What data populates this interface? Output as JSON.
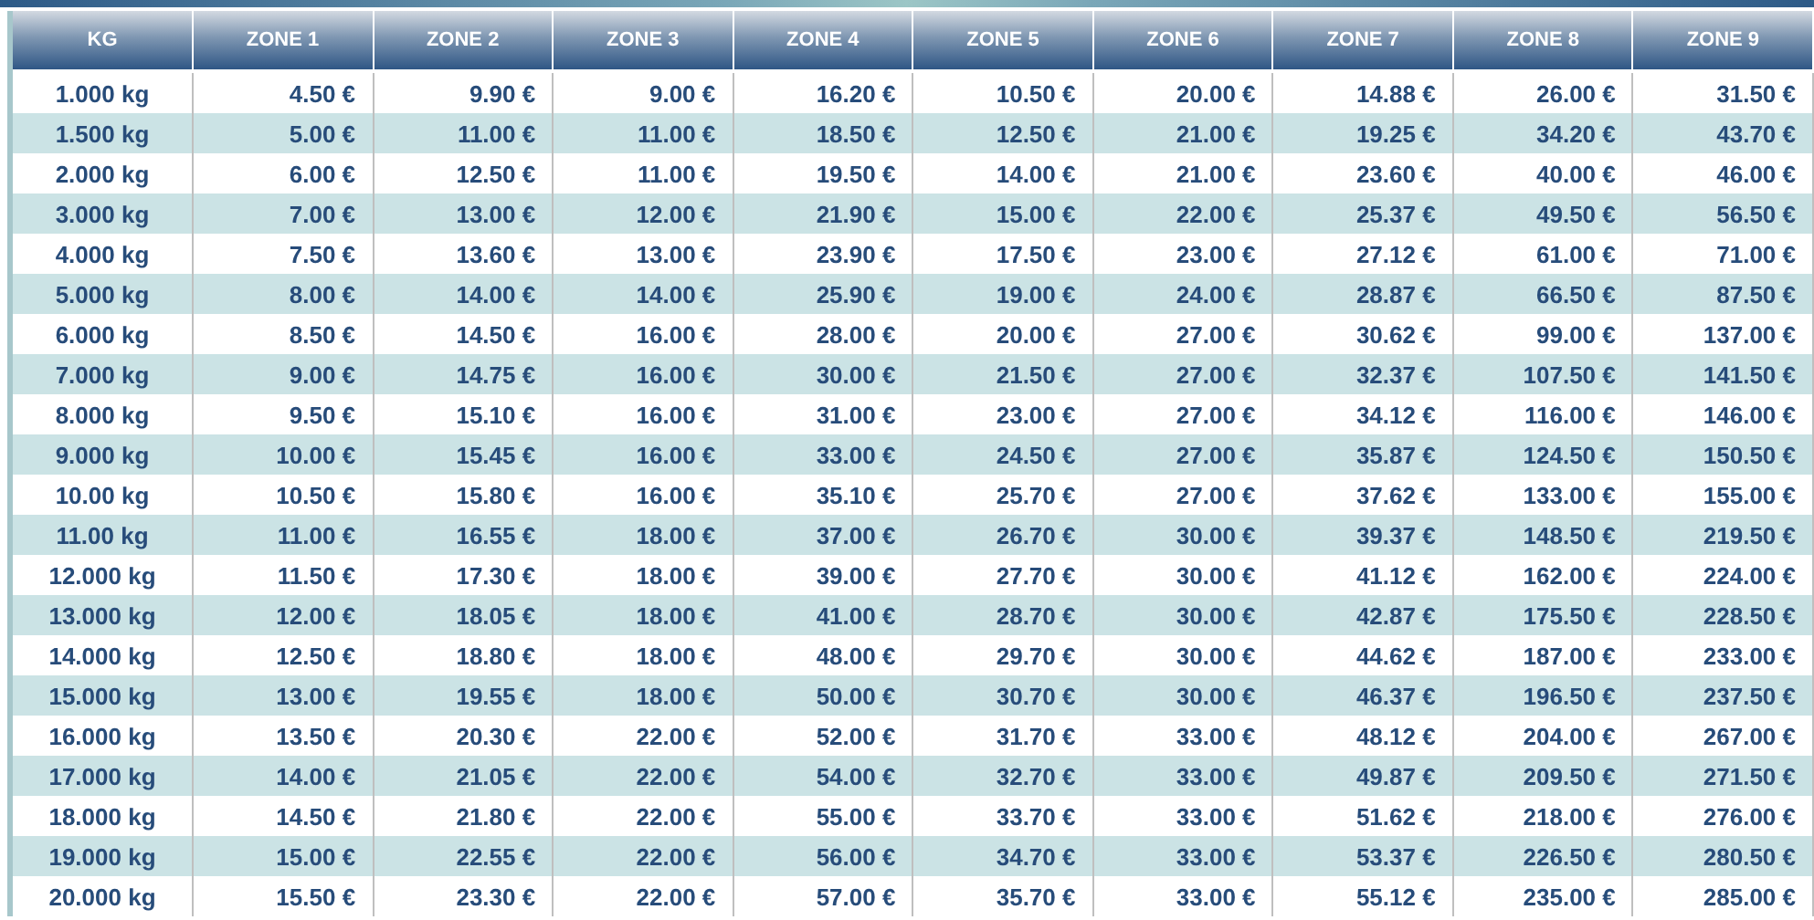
{
  "table": {
    "columns": [
      "KG",
      "ZONE 1",
      "ZONE 2",
      "ZONE 3",
      "ZONE 4",
      "ZONE 5",
      "ZONE 6",
      "ZONE 7",
      "ZONE 8",
      "ZONE 9"
    ],
    "rows": [
      [
        "1.000 kg",
        "4.50 €",
        "9.90 €",
        "9.00 €",
        "16.20 €",
        "10.50 €",
        "20.00 €",
        "14.88 €",
        "26.00 €",
        "31.50 €"
      ],
      [
        "1.500 kg",
        "5.00 €",
        "11.00 €",
        "11.00 €",
        "18.50 €",
        "12.50 €",
        "21.00 €",
        "19.25 €",
        "34.20 €",
        "43.70 €"
      ],
      [
        "2.000 kg",
        "6.00 €",
        "12.50 €",
        "11.00 €",
        "19.50 €",
        "14.00 €",
        "21.00 €",
        "23.60 €",
        "40.00 €",
        "46.00 €"
      ],
      [
        "3.000 kg",
        "7.00 €",
        "13.00 €",
        "12.00 €",
        "21.90 €",
        "15.00 €",
        "22.00 €",
        "25.37 €",
        "49.50 €",
        "56.50 €"
      ],
      [
        "4.000 kg",
        "7.50 €",
        "13.60 €",
        "13.00 €",
        "23.90 €",
        "17.50 €",
        "23.00 €",
        "27.12 €",
        "61.00 €",
        "71.00 €"
      ],
      [
        "5.000 kg",
        "8.00 €",
        "14.00 €",
        "14.00 €",
        "25.90 €",
        "19.00 €",
        "24.00 €",
        "28.87 €",
        "66.50 €",
        "87.50 €"
      ],
      [
        "6.000 kg",
        "8.50 €",
        "14.50 €",
        "16.00 €",
        "28.00 €",
        "20.00 €",
        "27.00 €",
        "30.62 €",
        "99.00 €",
        "137.00 €"
      ],
      [
        "7.000 kg",
        "9.00 €",
        "14.75 €",
        "16.00 €",
        "30.00 €",
        "21.50 €",
        "27.00 €",
        "32.37 €",
        "107.50 €",
        "141.50 €"
      ],
      [
        "8.000 kg",
        "9.50 €",
        "15.10 €",
        "16.00 €",
        "31.00 €",
        "23.00 €",
        "27.00 €",
        "34.12 €",
        "116.00 €",
        "146.00 €"
      ],
      [
        "9.000 kg",
        "10.00 €",
        "15.45 €",
        "16.00 €",
        "33.00 €",
        "24.50 €",
        "27.00 €",
        "35.87 €",
        "124.50 €",
        "150.50 €"
      ],
      [
        "10.00 kg",
        "10.50 €",
        "15.80 €",
        "16.00 €",
        "35.10 €",
        "25.70 €",
        "27.00 €",
        "37.62 €",
        "133.00 €",
        "155.00 €"
      ],
      [
        "11.00 kg",
        "11.00 €",
        "16.55 €",
        "18.00 €",
        "37.00 €",
        "26.70 €",
        "30.00 €",
        "39.37 €",
        "148.50 €",
        "219.50 €"
      ],
      [
        "12.000 kg",
        "11.50 €",
        "17.30 €",
        "18.00 €",
        "39.00 €",
        "27.70 €",
        "30.00 €",
        "41.12 €",
        "162.00 €",
        "224.00 €"
      ],
      [
        "13.000 kg",
        "12.00 €",
        "18.05 €",
        "18.00 €",
        "41.00 €",
        "28.70 €",
        "30.00 €",
        "42.87 €",
        "175.50 €",
        "228.50 €"
      ],
      [
        "14.000 kg",
        "12.50 €",
        "18.80 €",
        "18.00 €",
        "48.00 €",
        "29.70 €",
        "30.00 €",
        "44.62 €",
        "187.00 €",
        "233.00 €"
      ],
      [
        "15.000 kg",
        "13.00 €",
        "19.55 €",
        "18.00 €",
        "50.00 €",
        "30.70 €",
        "30.00 €",
        "46.37 €",
        "196.50 €",
        "237.50 €"
      ],
      [
        "16.000 kg",
        "13.50 €",
        "20.30 €",
        "22.00 €",
        "52.00 €",
        "31.70 €",
        "33.00 €",
        "48.12 €",
        "204.00 €",
        "267.00 €"
      ],
      [
        "17.000 kg",
        "14.00 €",
        "21.05 €",
        "22.00 €",
        "54.00 €",
        "32.70 €",
        "33.00 €",
        "49.87 €",
        "209.50 €",
        "271.50 €"
      ],
      [
        "18.000 kg",
        "14.50 €",
        "21.80 €",
        "22.00 €",
        "55.00 €",
        "33.70 €",
        "33.00 €",
        "51.62 €",
        "218.00 €",
        "276.00 €"
      ],
      [
        "19.000 kg",
        "15.00 €",
        "22.55 €",
        "22.00 €",
        "56.00 €",
        "34.70 €",
        "33.00 €",
        "53.37 €",
        "226.50 €",
        "280.50 €"
      ],
      [
        "20.000 kg",
        "15.50 €",
        "23.30 €",
        "22.00 €",
        "57.00 €",
        "35.70 €",
        "33.00 €",
        "55.12 €",
        "235.00 €",
        "285.00 €"
      ]
    ]
  }
}
